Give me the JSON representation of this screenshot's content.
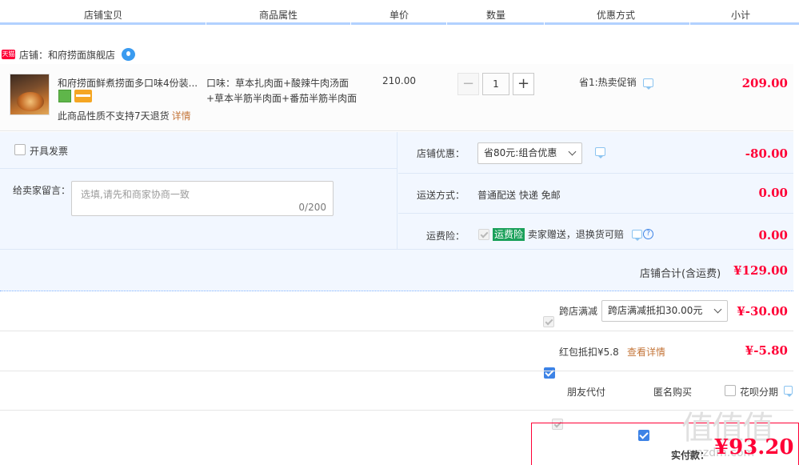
{
  "header": {
    "col_item": "店铺宝贝",
    "col_attr": "商品属性",
    "col_price": "单价",
    "col_qty": "数量",
    "col_promo": "优惠方式",
    "col_subtotal": "小计"
  },
  "shop": {
    "badge": "天猫",
    "label": "店铺：和府捞面旗舰店"
  },
  "item": {
    "title": "和府捞面鲜煮捞面多口味4份装...",
    "notice": "此商品性质不支持7天退货",
    "notice_link": "详情",
    "attr": "口味：草本扎肉面+酸辣牛肉汤面+草本半筋半肉面+番茄半筋半肉面",
    "unit_price": "210.00",
    "quantity": "1",
    "minus": "−",
    "plus": "+",
    "promo": "省1:热卖促销",
    "subtotal": "209.00"
  },
  "options": {
    "invoice_label": "开具发票",
    "message_label": "给卖家留言：",
    "message_placeholder": "选填,请先和商家协商一致",
    "message_count": "0/200",
    "shop_discount_label": "店铺优惠：",
    "shop_discount_value": "省80元:组合优惠",
    "shop_discount_amount": "-80.00",
    "shipping_label": "运送方式：",
    "shipping_value": "普通配送 快递 免邮",
    "shipping_amount": "0.00",
    "insurance_label": "运费险：",
    "insurance_tag": "运费险",
    "insurance_desc": "卖家赠送，退换货可赔",
    "insurance_amount": "0.00",
    "shop_total_label": "店铺合计(含运费)",
    "shop_total_value": "¥129.00"
  },
  "cross_store": {
    "label": "跨店满减",
    "select": "跨店满减抵扣30.00元",
    "amount": "¥-30.00"
  },
  "red_packet": {
    "label": "红包抵扣¥5.8",
    "link": "查看详情",
    "amount": "¥-5.80"
  },
  "payment_opts": {
    "friend_pay": "朋友代付",
    "anonymous": "匿名购买",
    "installment": "花呗分期"
  },
  "total": {
    "label": "实付款：",
    "value": "¥93.20"
  },
  "watermark": "值值值",
  "watermark_url": "smzdm.com",
  "colors": {
    "accent_red": "#ff0036",
    "accent_blue": "#3d83e6",
    "header_line": "#b2d1ff",
    "panel_bg": "#f2f7ff"
  }
}
